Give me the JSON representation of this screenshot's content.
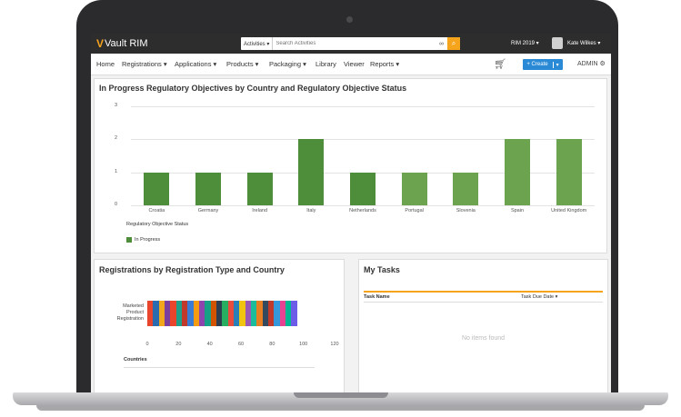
{
  "app": {
    "logo_v": "V",
    "logo_text": "Vault RIM",
    "search_scope": "Activities ▾",
    "search_placeholder": "Search Activities",
    "vault_selector": "RIM 2019 ▾",
    "user_name": "Kate Wilkes ▾"
  },
  "nav": {
    "items": [
      "Home",
      "Registrations ▾",
      "Applications ▾",
      "Products ▾",
      "Packaging ▾",
      "Library",
      "Viewer",
      "Reports ▾"
    ],
    "create_label": "+ Create",
    "create_caret": "▾",
    "admin_label": "ADMIN ⚙"
  },
  "colors": {
    "accent": "#f7a41d",
    "bar_green": "#4e8e3a",
    "create_blue": "#2b8ad6"
  },
  "panels": {
    "top_title": "In Progress Regulatory Objectives by Country and Regulatory Objective Status",
    "bottom_left_title": "Registrations by Registration Type and Country",
    "tasks_title": "My Tasks",
    "tasks_col1": "Task Name",
    "tasks_col2": "Task Due Date ▾",
    "tasks_empty": "No items found"
  },
  "chart_data": [
    {
      "type": "bar",
      "categories": [
        "Croatia",
        "Germany",
        "Ireland",
        "Italy",
        "Netherlands",
        "Portugal",
        "Slovenia",
        "Spain",
        "United Kingdom"
      ],
      "series": [
        {
          "name": "In Progress",
          "values": [
            1,
            1,
            1,
            2,
            1,
            1,
            1,
            2,
            2
          ]
        }
      ],
      "yticks": [
        "0",
        "1",
        "2",
        "3"
      ],
      "ylim": [
        0,
        3
      ],
      "legend_title": "Regulatory Objective Status",
      "legend_placement": "bottom-left",
      "grid": true
    },
    {
      "type": "bar",
      "orientation": "horizontal-stacked",
      "category_label": "Marketed Product Registration",
      "xticks": [
        "0",
        "20",
        "40",
        "60",
        "80",
        "100",
        "120"
      ],
      "xlim": [
        0,
        120
      ],
      "legend_title": "Countries",
      "total": 96,
      "segment_colors": [
        "#e8452c",
        "#2b6cb0",
        "#f2a61c",
        "#7b3fa0",
        "#e8452c",
        "#1f9e89",
        "#c0392b",
        "#3a7bd5",
        "#f39c12",
        "#8e44ad",
        "#16a085",
        "#d35400",
        "#2c3e50",
        "#27ae60",
        "#e74c3c",
        "#2980b9",
        "#f1c40f",
        "#9b59b6",
        "#1abc9c",
        "#e67e22",
        "#34495e",
        "#c0392b",
        "#3498db",
        "#e84393",
        "#00b894",
        "#6c5ce7"
      ]
    }
  ]
}
